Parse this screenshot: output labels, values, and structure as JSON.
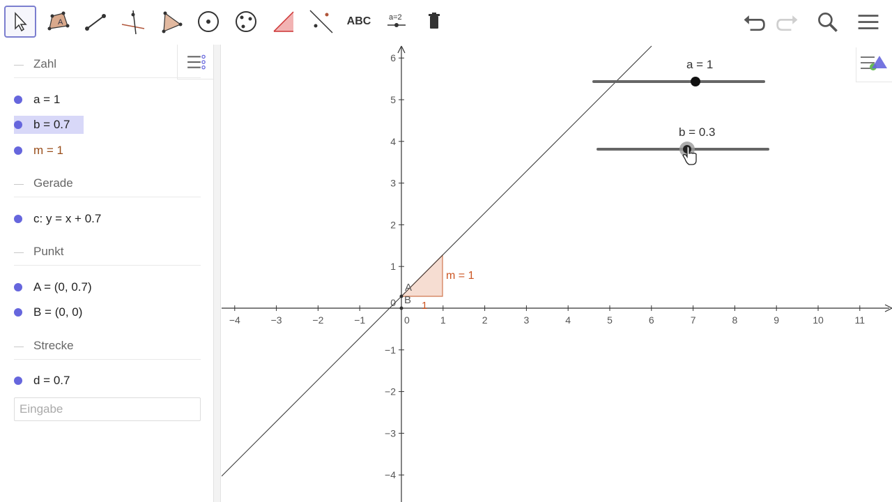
{
  "toolbar": {
    "tools": [
      {
        "name": "move-tool",
        "icon": "arrow-cursor-icon"
      },
      {
        "name": "polygon-tool",
        "icon": "labeled-polygon-icon",
        "label": "A"
      },
      {
        "name": "segment-tool",
        "icon": "segment-icon"
      },
      {
        "name": "perpendicular-tool",
        "icon": "perpendicular-icon"
      },
      {
        "name": "polygon-shape-tool",
        "icon": "triangle-icon"
      },
      {
        "name": "circle-center-tool",
        "icon": "circle-center-icon"
      },
      {
        "name": "circle-three-points-tool",
        "icon": "circle-three-points-icon"
      },
      {
        "name": "angle-tool",
        "icon": "angle-icon"
      },
      {
        "name": "reflect-tool",
        "icon": "reflect-line-icon"
      },
      {
        "name": "text-tool",
        "label": "ABC"
      },
      {
        "name": "slider-tool",
        "label": "a=2"
      },
      {
        "name": "delete-tool",
        "icon": "trash-icon"
      }
    ],
    "right": [
      "undo-icon",
      "redo-icon",
      "search-icon",
      "menu-icon"
    ]
  },
  "algebra": {
    "groups": [
      {
        "header": "Zahl",
        "items": [
          "a = 1",
          "b = 0.7",
          "m = 1"
        ]
      },
      {
        "header": "Gerade",
        "items": [
          "c: y = x + 0.7"
        ]
      },
      {
        "header": "Punkt",
        "items": [
          "A = (0, 0.7)",
          "B = (0, 0)"
        ]
      },
      {
        "header": "Strecke",
        "items": [
          "d = 0.7"
        ]
      }
    ],
    "input_placeholder": "Eingabe"
  },
  "graphics": {
    "x_ticks": [
      "−4",
      "−3",
      "−2",
      "−1",
      "0",
      "1",
      "2",
      "3",
      "4",
      "5",
      "6",
      "7",
      "8",
      "9",
      "10",
      "11"
    ],
    "y_ticks": [
      "6",
      "5",
      "4",
      "3",
      "2",
      "1",
      "−1",
      "−2",
      "−3",
      "−4"
    ],
    "origin_label": "0",
    "slider_a_label": "a = 1",
    "slider_b_label": "b = 0.3",
    "slope_label": "m = 1",
    "slope_run_label": "1",
    "point_A_label": "A",
    "point_B_label": "B",
    "line_color": "#333333",
    "slope_color": "#cc5522",
    "point_color": "#6666dd"
  }
}
